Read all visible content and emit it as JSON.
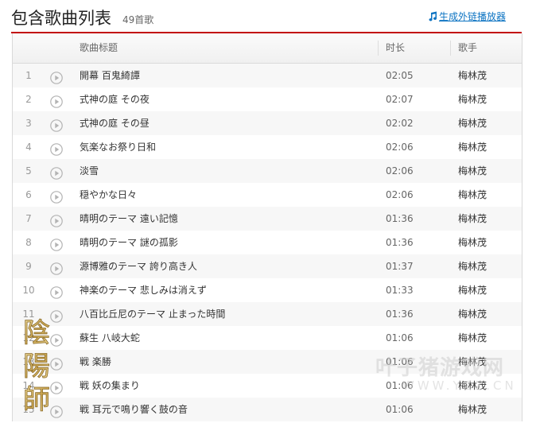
{
  "header": {
    "title": "包含歌曲列表",
    "count": "49首歌",
    "generate_link": "生成外链播放器",
    "accent_color": "#c20c0c",
    "link_color": "#0c73c2"
  },
  "columns": {
    "title": "歌曲标题",
    "duration": "时长",
    "artist": "歌手"
  },
  "songs": [
    {
      "num": "1",
      "title": "開幕 百鬼綺譚",
      "duration": "02:05",
      "artist": "梅林茂"
    },
    {
      "num": "2",
      "title": "式神の庭 その夜",
      "duration": "02:07",
      "artist": "梅林茂"
    },
    {
      "num": "3",
      "title": "式神の庭 その昼",
      "duration": "02:02",
      "artist": "梅林茂"
    },
    {
      "num": "4",
      "title": "気楽なお祭り日和",
      "duration": "02:06",
      "artist": "梅林茂"
    },
    {
      "num": "5",
      "title": "淡雪",
      "duration": "02:06",
      "artist": "梅林茂"
    },
    {
      "num": "6",
      "title": "穏やかな日々",
      "duration": "02:06",
      "artist": "梅林茂"
    },
    {
      "num": "7",
      "title": "晴明のテーマ 遠い記憶",
      "duration": "01:36",
      "artist": "梅林茂"
    },
    {
      "num": "8",
      "title": "晴明のテーマ 謎の孤影",
      "duration": "01:36",
      "artist": "梅林茂"
    },
    {
      "num": "9",
      "title": "源博雅のテーマ 誇り高き人",
      "duration": "01:37",
      "artist": "梅林茂"
    },
    {
      "num": "10",
      "title": "神楽のテーマ 悲しみは消えず",
      "duration": "01:33",
      "artist": "梅林茂"
    },
    {
      "num": "11",
      "title": "八百比丘尼のテーマ 止まった時間",
      "duration": "01:36",
      "artist": "梅林茂"
    },
    {
      "num": "12",
      "title": "蘇生 八岐大蛇",
      "duration": "01:06",
      "artist": "梅林茂"
    },
    {
      "num": "13",
      "title": "戦 楽勝",
      "duration": "01:06",
      "artist": "梅林茂"
    },
    {
      "num": "14",
      "title": "戦 妖の集まり",
      "duration": "01:06",
      "artist": "梅林茂"
    },
    {
      "num": "15",
      "title": "戦 耳元で鳴り響く鼓の音",
      "duration": "01:06",
      "artist": "梅林茂"
    }
  ],
  "watermark": {
    "left_text": "陰陽師",
    "right_text": "叶子猪游戏网",
    "right_url": "WWW.YZZ.CN"
  },
  "icons": {
    "play": "play-circle-icon",
    "music_note": "music-note-icon"
  }
}
